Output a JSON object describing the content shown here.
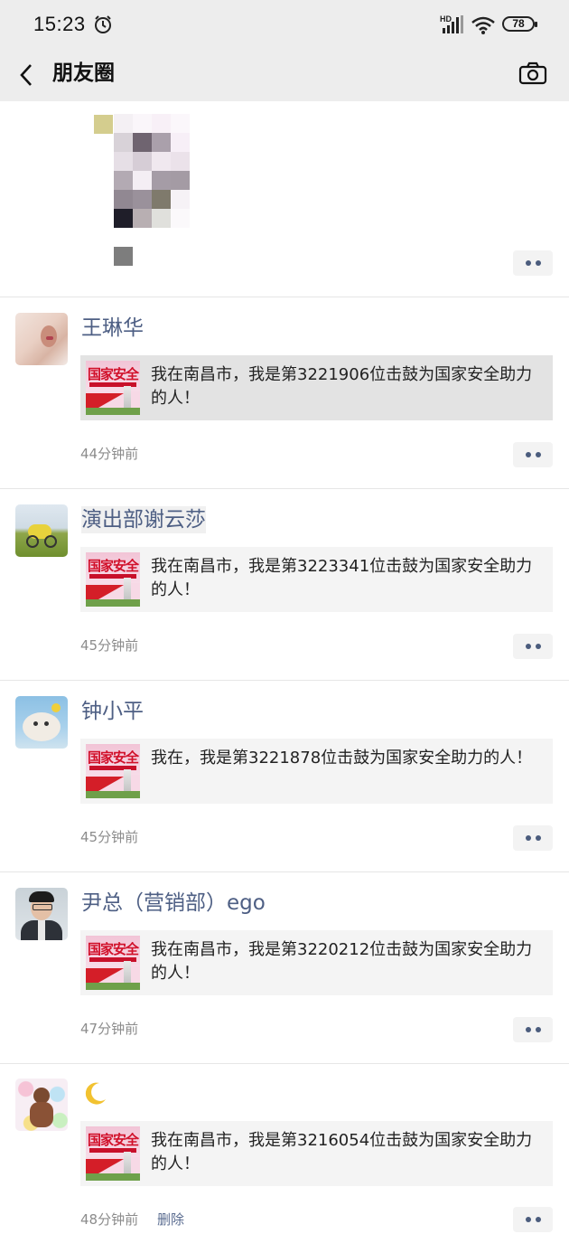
{
  "status": {
    "time": "15:23",
    "battery": "78",
    "signal_label": "HD"
  },
  "nav": {
    "title": "朋友圈"
  },
  "posts": [
    {
      "name": "王琳华",
      "text": "我在南昌市，我是第3221906位击鼓为国家安全助力的人！",
      "time": "44分钟前",
      "avatar": "avatar-photo"
    },
    {
      "name": "演出部谢云莎",
      "text": "我在南昌市，我是第3223341位击鼓为国家安全助力的人！",
      "time": "45分钟前",
      "avatar": "avatar-photo"
    },
    {
      "name": "钟小平",
      "text": "我在，我是第3221878位击鼓为国家安全助力的人！",
      "time": "45分钟前",
      "avatar": "avatar-photo"
    },
    {
      "name": "尹总（营销部）ego",
      "text": "我在南昌市，我是第3220212位击鼓为国家安全助力的人！",
      "time": "47分钟前",
      "avatar": "avatar-photo"
    },
    {
      "name": "",
      "name_icon": "crescent-moon-emoji",
      "text": "我在南昌市，我是第3216054位击鼓为国家安全助力的人！",
      "time": "48分钟前",
      "delete_label": "删除",
      "avatar": "avatar-photo"
    }
  ],
  "share_thumb": {
    "title": "国家安全"
  },
  "icons": {
    "back": "back-chevron-icon",
    "camera": "camera-icon",
    "more": "more-dots-icon",
    "alarm": "alarm-icon",
    "wifi": "wifi-icon",
    "signal": "signal-icon",
    "battery": "battery-icon"
  },
  "colors": {
    "name": "#4e5f84",
    "bar": "#ededed",
    "card": "#f4f4f4",
    "time": "#8c8c8c",
    "link": "#5a6c90"
  }
}
